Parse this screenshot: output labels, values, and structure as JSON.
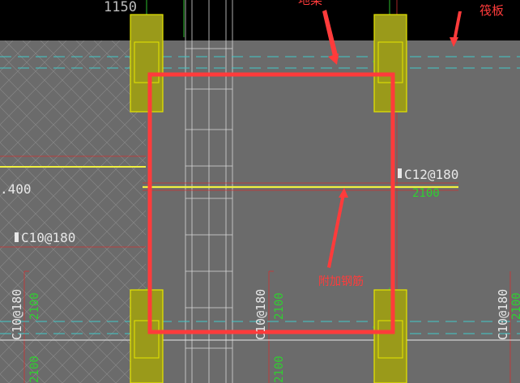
{
  "drawing": {
    "dimension_top": "1150",
    "callouts": {
      "ground_beam": "地梁",
      "raft_slab": "筏板",
      "additional_rebar": "附加钢筋"
    },
    "rebar_labels": {
      "c12": "C12@180",
      "c12_length": "2100",
      "c10_left_horizontal": "C10@180",
      "elevation_left": ".400",
      "c10_vertical_1": "C10@180",
      "c10_vertical_1_length": "2100",
      "c10_vertical_2": "C10@180",
      "c10_vertical_2_length": "2100",
      "c10_vertical_3": "C10@180",
      "c10_vertical_3_length": "2100",
      "bottom_length_1": "2100",
      "bottom_length_2": "2100"
    },
    "colors": {
      "background_top": "#000000",
      "slab_fill": "#6b6b6b",
      "column_fill": "#9a9a1a",
      "column_stroke": "#e6e600",
      "highlight": "#ff3b3b",
      "cyan": "#40c8c8",
      "green": "#30d030",
      "white": "#e8e8e8",
      "yellow": "#f0f040",
      "dim_red": "#d03030"
    }
  }
}
